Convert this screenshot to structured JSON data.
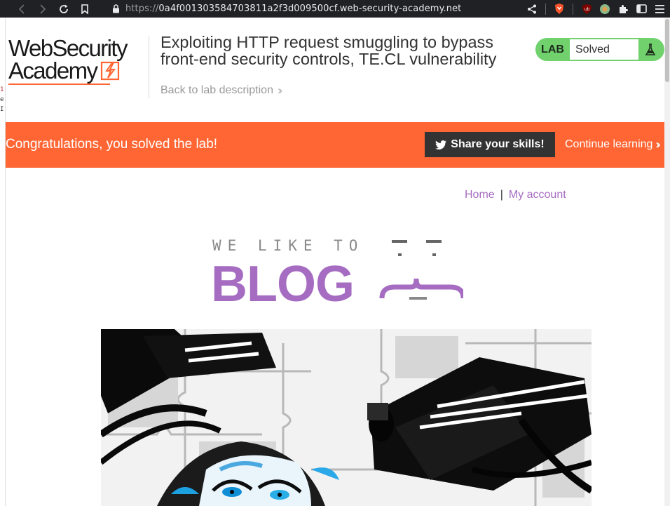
{
  "browser": {
    "url_prefix": "https://",
    "url_host": "0a4f001303584703811a2f3d009500cf.web-security-academy.net"
  },
  "sliver": [
    "1",
    "e",
    "I"
  ],
  "academy": {
    "logo_line1": "WebSecurity",
    "logo_line2": "Academy",
    "lab_title": "Exploiting HTTP request smuggling to bypass front-end security controls, TE.CL vulnerability",
    "back_link": "Back to lab description",
    "status_label": "LAB",
    "status_value": "Solved",
    "colors": {
      "accent": "#ff6633",
      "solved": "#70d16d"
    }
  },
  "banner": {
    "message": "Congratulations, you solved the lab!",
    "share_label": "Share your skills!",
    "continue_label": "Continue learning"
  },
  "blog": {
    "nav_home": "Home",
    "nav_separator": "|",
    "nav_account": "My account",
    "logo_top": "WE LIKE TO",
    "logo_main": "BLOG",
    "accent": "#a56cc1"
  }
}
